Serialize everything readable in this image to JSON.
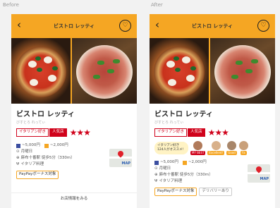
{
  "captions": {
    "before": "Before",
    "after": "After"
  },
  "app": {
    "restaurant_title": "ビストロ レッティ",
    "back_glyph": "‹",
    "heart_glyph": "♡"
  },
  "restaurant": {
    "name": "ビストロ レッティ",
    "reading": "びすとろ れってぃ",
    "tag_genre": "イタリアン好き",
    "tag_popular": "人気店",
    "stars": "★★★",
    "dinner_price": "~5,000円",
    "lunch_price": "~2,000円",
    "closed_day": "月曜日",
    "access": "麻布十番駅 徒歩5分（330m）",
    "cuisine": "イタリア料理",
    "paypay_label": "PayPayボーナス対象",
    "delivery_label": "デリバリーあり",
    "more_label": "お店情報をみる"
  },
  "map": {
    "label": "MAP"
  },
  "recommendation": {
    "text": "イタリアン好き 124人がオススメ!",
    "users": [
      {
        "label": "MY BEST",
        "color": "#d0021b"
      },
      {
        "label": "Excellent!",
        "color": "#f5a623"
      },
      {
        "label": "Good",
        "color": "#f5a623"
      },
      {
        "label": "Fa",
        "color": "#f5a623"
      }
    ]
  },
  "icons": {
    "dinner": "dinner-icon",
    "lunch": "lunch-icon",
    "closed": "clock-icon",
    "access": "location-icon",
    "cuisine": "cutlery-icon"
  },
  "colors": {
    "brand": "#f5a623",
    "accent": "#d0021b",
    "dinner_chip": "#3b4ea0"
  }
}
